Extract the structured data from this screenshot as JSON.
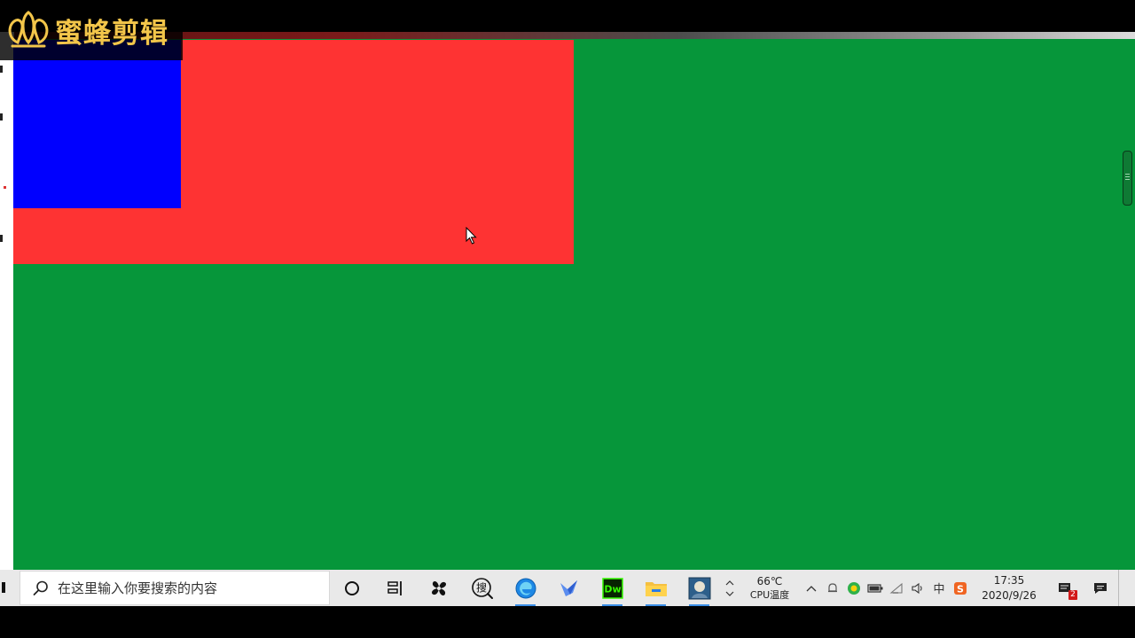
{
  "watermark": {
    "brand_text": "蜜蜂剪辑",
    "icon": "bee-logo-icon",
    "color": "#f3c64a"
  },
  "page": {
    "background_color": "#06963a",
    "red_box_color": "#fe3333",
    "blue_box_color": "#0000ff"
  },
  "taskbar": {
    "search": {
      "placeholder": "在这里输入你要搜索的内容",
      "icon": "search-icon"
    },
    "pinned": [
      {
        "name": "cortana",
        "icon": "circle-icon"
      },
      {
        "name": "task-view",
        "icon": "task-view-icon"
      },
      {
        "name": "pinwheel-app",
        "icon": "pinwheel-icon"
      },
      {
        "name": "sogou-search",
        "icon": "sou-icon",
        "glyph": "搜"
      },
      {
        "name": "edge",
        "icon": "edge-icon",
        "active": true
      },
      {
        "name": "feishu",
        "icon": "bird-icon"
      },
      {
        "name": "dreamweaver",
        "icon": "dw-icon",
        "glyph": "Dw",
        "active": true
      },
      {
        "name": "file-explorer",
        "icon": "folder-icon",
        "active": true
      },
      {
        "name": "photo-app",
        "icon": "photo-icon",
        "active": true
      }
    ],
    "cpu": {
      "temperature": "66℃",
      "label": "CPU温度"
    },
    "tray": {
      "ime": "中",
      "sogou": "S"
    },
    "clock": {
      "time": "17:35",
      "date": "2020/9/26"
    },
    "notifications": {
      "count": "2"
    }
  }
}
